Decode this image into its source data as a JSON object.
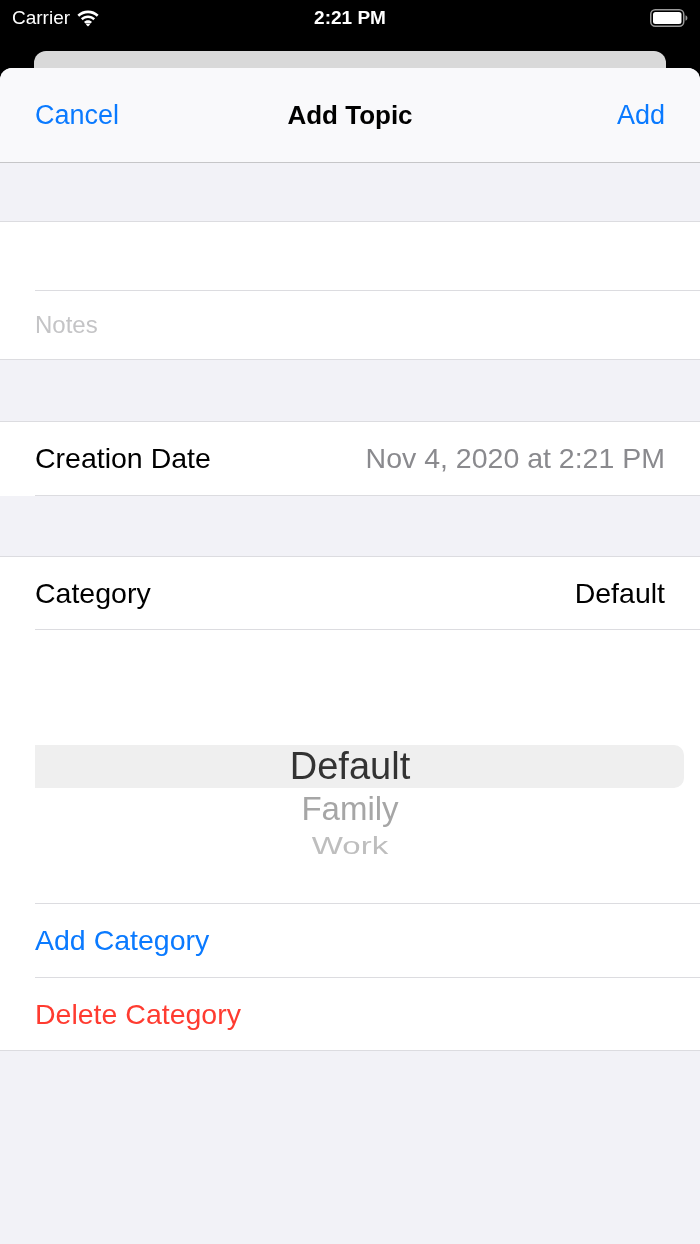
{
  "status_bar": {
    "carrier": "Carrier",
    "time": "2:21 PM"
  },
  "nav_bar": {
    "left_button": "Cancel",
    "title": "Add Topic",
    "right_button": "Add"
  },
  "notes_field": {
    "placeholder": "Notes"
  },
  "creation_date": {
    "label": "Creation Date",
    "value": "Nov 4, 2020 at 2:21 PM"
  },
  "category": {
    "label": "Category",
    "value": "Default"
  },
  "picker": {
    "options": [
      {
        "label": "Default",
        "selected": true
      },
      {
        "label": "Family",
        "selected": false
      },
      {
        "label": "Work",
        "selected": false
      }
    ]
  },
  "actions": [
    {
      "label": "Add Category",
      "kind": "normal"
    },
    {
      "label": "Delete Category",
      "kind": "destructive"
    }
  ]
}
